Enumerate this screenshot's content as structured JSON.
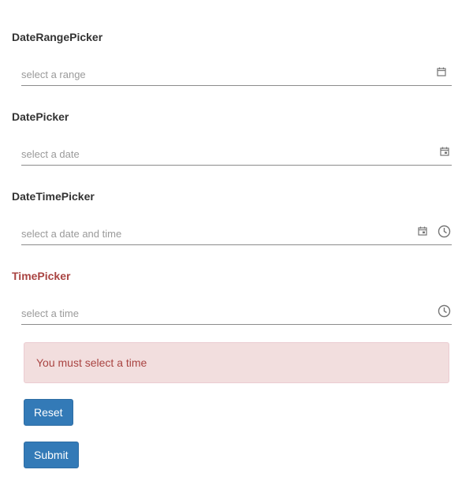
{
  "fields": {
    "daterange": {
      "label": "DateRangePicker",
      "placeholder": "select a range"
    },
    "date": {
      "label": "DatePicker",
      "placeholder": "select a date"
    },
    "datetime": {
      "label": "DateTimePicker",
      "placeholder": "select a date and time"
    },
    "time": {
      "label": "TimePicker",
      "placeholder": "select a time"
    }
  },
  "alert": {
    "message": "You must select a time"
  },
  "buttons": {
    "reset_label": "Reset",
    "submit_label": "Submit"
  },
  "colors": {
    "error_text": "#a94442",
    "error_bg": "#f2dede",
    "primary": "#337ab7"
  },
  "icons": {
    "daterange": "calendar-range-icon",
    "date": "calendar-icon",
    "time": "clock-icon"
  }
}
